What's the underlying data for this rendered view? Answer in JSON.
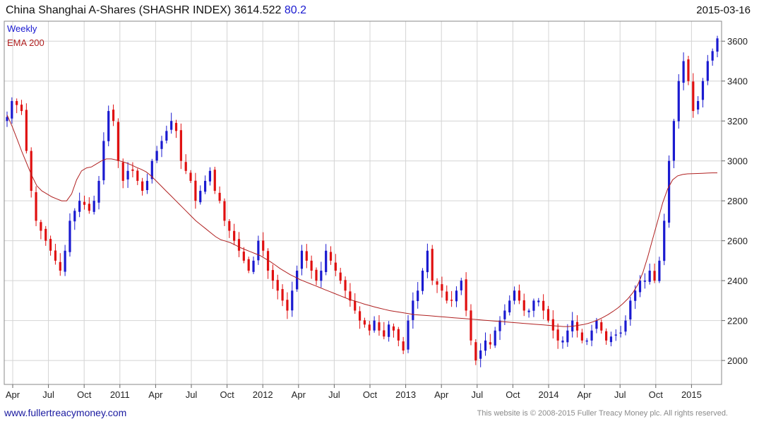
{
  "header": {
    "title": "China Shanghai A-Shares (SHASHR INDEX) 3614.522",
    "change": "80.2",
    "date": "2015-03-16"
  },
  "footer": {
    "website": "www.fullertreacymoney.com",
    "copyright": "This website is © 2008-2015 Fuller Treacy Money plc. All rights reserved."
  },
  "colors": {
    "up": "#1a1ad0",
    "down": "#e01010",
    "ema": "#b02020",
    "grid": "#d4d4d4"
  },
  "chart_data": {
    "type": "candlestick",
    "legend": [
      {
        "label": "Weekly",
        "color": "#1a1ad0"
      },
      {
        "label": "EMA 200",
        "color": "#b02020"
      }
    ],
    "legend_position": "top-left",
    "y_axis": {
      "position": "right",
      "ylim": [
        1880,
        3700
      ],
      "ticks": [
        2000,
        2200,
        2400,
        2600,
        2800,
        3000,
        3200,
        3400,
        3600
      ]
    },
    "x_axis": {
      "labels": [
        "Apr",
        "Jul",
        "Oct",
        "2011",
        "Apr",
        "Jul",
        "Oct",
        "2012",
        "Apr",
        "Jul",
        "Oct",
        "2013",
        "Apr",
        "Jul",
        "Oct",
        "2014",
        "Apr",
        "Jul",
        "Oct",
        "2015"
      ]
    },
    "grid": true,
    "close_series": {
      "name": "Weekly",
      "values": [
        3220,
        3300,
        3280,
        3250,
        3050,
        2850,
        2700,
        2650,
        2600,
        2550,
        2500,
        2450,
        2550,
        2700,
        2750,
        2800,
        2780,
        2750,
        2800,
        2900,
        3100,
        3250,
        3200,
        3000,
        2900,
        2950,
        2950,
        2900,
        2850,
        2900,
        3000,
        3050,
        3100,
        3150,
        3200,
        3150,
        3000,
        2950,
        2900,
        2800,
        2850,
        2900,
        2950,
        2850,
        2800,
        2700,
        2650,
        2600,
        2550,
        2500,
        2450,
        2500,
        2600,
        2550,
        2450,
        2400,
        2350,
        2300,
        2250,
        2350,
        2450,
        2550,
        2500,
        2450,
        2400,
        2450,
        2550,
        2500,
        2450,
        2400,
        2350,
        2300,
        2250,
        2200,
        2180,
        2150,
        2200,
        2150,
        2120,
        2180,
        2150,
        2100,
        2050,
        2200,
        2300,
        2350,
        2450,
        2550,
        2400,
        2380,
        2350,
        2300,
        2300,
        2350,
        2400,
        2250,
        2100,
        2000,
        2050,
        2100,
        2080,
        2150,
        2200,
        2250,
        2300,
        2350,
        2300,
        2250,
        2250,
        2300,
        2300,
        2250,
        2200,
        2150,
        2100,
        2100,
        2150,
        2200,
        2150,
        2100,
        2100,
        2150,
        2200,
        2150,
        2100,
        2120,
        2130,
        2140,
        2200,
        2300,
        2350,
        2400,
        2400,
        2450,
        2400,
        2500,
        2700,
        3000,
        3200,
        3400,
        3500,
        3400,
        3250,
        3300,
        3400,
        3500,
        3550,
        3614
      ]
    },
    "ema_series": {
      "name": "EMA 200",
      "values": [
        3230,
        3175,
        3110,
        3045,
        2985,
        2925,
        2875,
        2850,
        2835,
        2820,
        2810,
        2800,
        2800,
        2835,
        2905,
        2950,
        2965,
        2970,
        2985,
        3000,
        3010,
        3010,
        3005,
        2998,
        2990,
        2980,
        2968,
        2958,
        2945,
        2925,
        2900,
        2875,
        2850,
        2825,
        2800,
        2775,
        2750,
        2725,
        2700,
        2680,
        2660,
        2640,
        2620,
        2605,
        2598,
        2590,
        2578,
        2565,
        2555,
        2545,
        2535,
        2525,
        2510,
        2495,
        2478,
        2460,
        2445,
        2430,
        2418,
        2405,
        2395,
        2385,
        2375,
        2365,
        2355,
        2345,
        2335,
        2325,
        2315,
        2305,
        2298,
        2290,
        2282,
        2275,
        2268,
        2262,
        2256,
        2250,
        2246,
        2242,
        2238,
        2234,
        2230,
        2228,
        2226,
        2224,
        2222,
        2220,
        2218,
        2216,
        2214,
        2212,
        2210,
        2208,
        2206,
        2204,
        2202,
        2200,
        2198,
        2196,
        2194,
        2192,
        2190,
        2188,
        2186,
        2184,
        2182,
        2180,
        2178,
        2176,
        2174,
        2172,
        2170,
        2170,
        2172,
        2176,
        2180,
        2186,
        2194,
        2204,
        2216,
        2230,
        2246,
        2264,
        2285,
        2310,
        2340,
        2380,
        2440,
        2520,
        2610,
        2700,
        2790,
        2860,
        2905,
        2925,
        2932,
        2935,
        2936,
        2937,
        2938,
        2939,
        2940,
        2940
      ]
    }
  }
}
